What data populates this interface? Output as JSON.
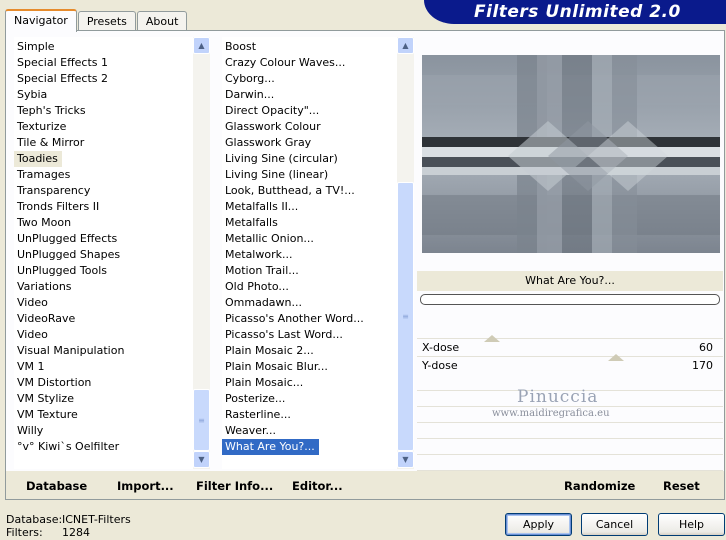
{
  "app": {
    "title": "Filters Unlimited 2.0"
  },
  "tabs": [
    {
      "label": "Navigator",
      "active": true
    },
    {
      "label": "Presets",
      "active": false
    },
    {
      "label": "About",
      "active": false
    }
  ],
  "categories": {
    "items": [
      "Simple",
      "Special Effects 1",
      "Special Effects 2",
      "Sybia",
      "Teph's Tricks",
      "Texturize",
      "Tile & Mirror",
      "Toadies",
      "Tramages",
      "Transparency",
      "Tronds Filters II",
      "Two Moon",
      "UnPlugged Effects",
      "UnPlugged Shapes",
      "UnPlugged Tools",
      "Variations",
      "Video",
      "VideoRave",
      "Video",
      "Visual Manipulation",
      "VM 1",
      "VM Distortion",
      "VM Stylize",
      "VM Texture",
      "Willy",
      "°v° Kiwi`s Oelfilter"
    ],
    "selected": "Toadies"
  },
  "filters": {
    "items": [
      "Boost",
      "Crazy Colour Waves...",
      "Cyborg...",
      "Darwin...",
      "Direct Opacity\"...",
      "Glasswork Colour",
      "Glasswork Gray",
      "Living Sine (circular)",
      "Living Sine (linear)",
      "Look, Butthead, a TV!...",
      "Metalfalls II...",
      "Metalfalls",
      "Metallic Onion...",
      "Metalwork...",
      "Motion Trail...",
      "Old Photo...",
      "Ommadawn...",
      "Picasso's Another Word...",
      "Picasso's Last Word...",
      "Plain Mosaic 2...",
      "Plain Mosaic Blur...",
      "Plain Mosaic...",
      "Posterize...",
      "Rasterline...",
      "Weaver...",
      "What Are You?..."
    ],
    "selected": "What Are You?..."
  },
  "preview": {
    "filter_name": "What Are You?..."
  },
  "params": [
    {
      "label": "X-dose",
      "value": "60",
      "level": 0.24
    },
    {
      "label": "Y-dose",
      "value": "170",
      "level": 0.67
    }
  ],
  "watermark": {
    "name": "Pinuccia",
    "url": "www.maidiregrafica.eu"
  },
  "toolbar": {
    "database": "Database",
    "import": "Import...",
    "filter_info": "Filter Info...",
    "editor": "Editor...",
    "randomize": "Randomize",
    "reset": "Reset"
  },
  "status": {
    "database_label": "Database:",
    "database_value": "ICNET-Filters",
    "filters_label": "Filters:",
    "filters_value": "1284"
  },
  "buttons": {
    "apply": "Apply",
    "cancel": "Cancel",
    "help": "Help"
  },
  "colors": {
    "banner": "#0a1a8c",
    "selection": "#316ac5",
    "scroll": "#c1d3fb"
  }
}
